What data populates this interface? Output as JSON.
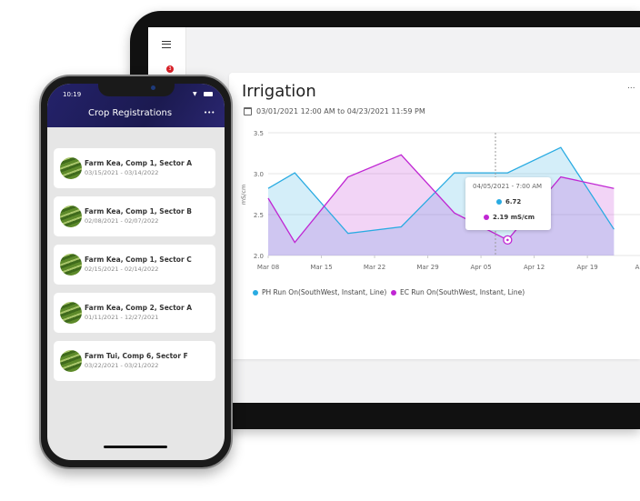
{
  "tablet": {
    "sidebar": {
      "menu_icon": "hamburger-icon",
      "notification_count": "3"
    },
    "card": {
      "title": "Irrigation",
      "date_range": "03/01/2021 12:00 AM to 04/23/2021 11:59 PM",
      "more_label": "..."
    },
    "tooltip": {
      "date": "04/05/2021 - 7:00 AM",
      "ph_value": "6.72",
      "ec_value": "2.19 mS/cm"
    }
  },
  "chart_data": {
    "type": "area",
    "ylabel": "mS/cm",
    "ylim": [
      2.0,
      3.5
    ],
    "yticks": [
      "3.5",
      "3.0",
      "2.5",
      "2.0"
    ],
    "xticks": [
      "Mar 08",
      "Mar 15",
      "Mar 22",
      "Mar 29",
      "Apr 05",
      "Apr 12",
      "Apr 19",
      "Apr"
    ],
    "grid": true,
    "legend_position": "bottom-left",
    "x": [
      "2021-03-08 00:00",
      "2021-03-11 12:00",
      "2021-03-18 12:00",
      "2021-03-25 12:00",
      "2021-04-01 12:00",
      "2021-04-08 12:00",
      "2021-04-15 12:00",
      "2021-04-22 12:00"
    ],
    "series": [
      {
        "name": "PH Run On(SouthWest, Instant, Line)",
        "color": "#29abe2",
        "values": [
          2.82,
          3.01,
          2.27,
          2.35,
          3.01,
          3.01,
          3.32,
          2.32
        ]
      },
      {
        "name": "EC Run On(SouthWest, Instant, Line)",
        "color": "#c026d3",
        "values": [
          2.7,
          2.16,
          2.96,
          3.23,
          2.52,
          2.19,
          2.96,
          2.82
        ]
      }
    ]
  },
  "phone": {
    "time": "10:19",
    "title": "Crop Registrations",
    "more_label": "•••",
    "items": [
      {
        "name": "Farm Kea, Comp 1, Sector A",
        "dates": "03/15/2021 - 03/14/2022"
      },
      {
        "name": "Farm Kea, Comp 1, Sector B",
        "dates": "02/08/2021 - 02/07/2022"
      },
      {
        "name": "Farm Kea, Comp 1, Sector C",
        "dates": "02/15/2021 - 02/14/2022"
      },
      {
        "name": "Farm Kea, Comp 2, Sector  A",
        "dates": "01/11/2021 - 12/27/2021"
      },
      {
        "name": "Farm Tui, Comp 6, Sector F",
        "dates": "03/22/2021 - 03/21/2022"
      }
    ]
  }
}
